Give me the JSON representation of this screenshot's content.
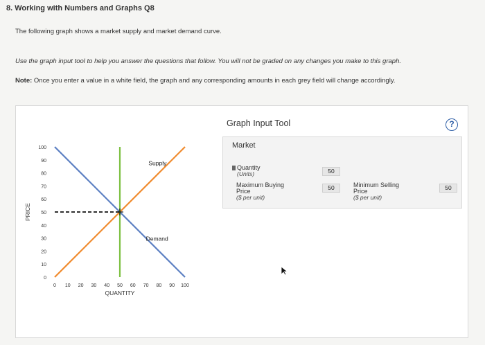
{
  "question": {
    "title": "8. Working with Numbers and Graphs Q8",
    "intro": "The following graph shows a market supply and market demand curve.",
    "instructions": "Use the graph input tool to help you answer the questions that follow. You will not be graded on any changes you make to this graph.",
    "note_label": "Note:",
    "note_text": " Once you enter a value in a white field, the graph and any corresponding amounts in each grey field will change accordingly."
  },
  "graph_tool": {
    "title": "Graph Input Tool",
    "help_icon": "?",
    "market_label": "Market",
    "quantity_label": "Quantity",
    "quantity_unit": "(Units)",
    "quantity_value": "50",
    "max_buying_label_1": "Maximum Buying",
    "max_buying_label_2": "Price",
    "max_buying_unit": "($ per unit)",
    "max_buying_value": "50",
    "min_selling_label_1": "Minimum Selling",
    "min_selling_label_2": "Price",
    "min_selling_unit": "($ per unit)",
    "min_selling_value": "50"
  },
  "chart_data": {
    "type": "line",
    "xlabel": "QUANTITY",
    "ylabel": "PRICE",
    "xlim": [
      0,
      100
    ],
    "ylim": [
      0,
      100
    ],
    "x_ticks": [
      0,
      10,
      20,
      30,
      40,
      50,
      60,
      70,
      80,
      90,
      100
    ],
    "y_ticks": [
      0,
      10,
      20,
      30,
      40,
      50,
      60,
      70,
      80,
      90,
      100
    ],
    "series": [
      {
        "name": "Supply",
        "color": "#f08a2c",
        "x": [
          0,
          100
        ],
        "y": [
          0,
          100
        ]
      },
      {
        "name": "Demand",
        "color": "#5b7fc2",
        "x": [
          0,
          100
        ],
        "y": [
          100,
          0
        ]
      }
    ],
    "vertical_line": {
      "x": 50,
      "color": "#7dc142"
    },
    "price_guide": {
      "y": 50,
      "from_x": 0,
      "to_x": 50,
      "style": "dashed"
    },
    "marker": {
      "x": 50,
      "y": 50,
      "symbol": "+"
    }
  }
}
